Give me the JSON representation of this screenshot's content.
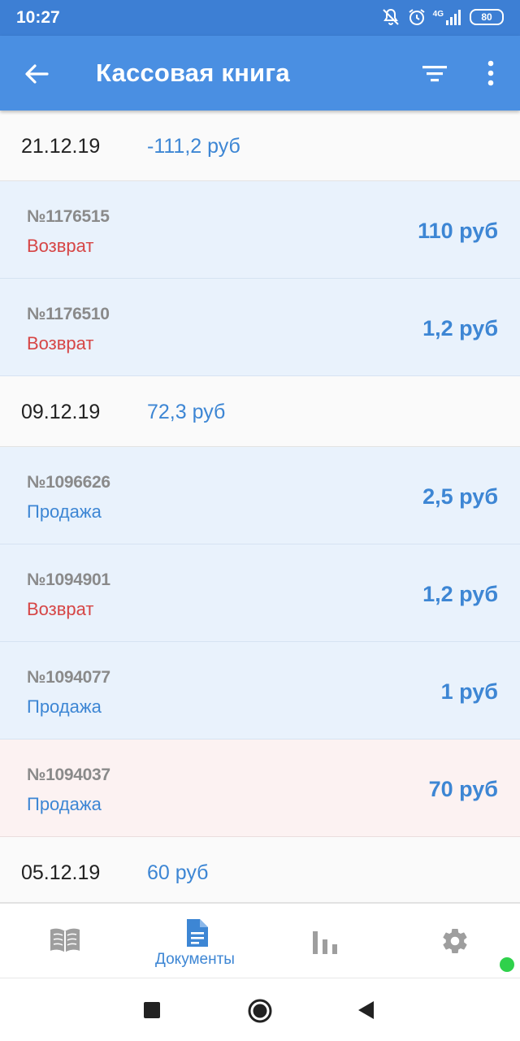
{
  "status_bar": {
    "time": "10:27",
    "network": "4G",
    "battery": "80",
    "icons": [
      "notifications-off-icon",
      "alarm-icon",
      "signal-icon",
      "battery-icon"
    ]
  },
  "app_bar": {
    "title": "Кассовая книга",
    "back_icon": "arrow-left-icon",
    "filter_icon": "filter-icon",
    "more_icon": "more-vertical-icon"
  },
  "list": [
    {
      "kind": "date",
      "date": "21.12.19",
      "total": "-111,2 руб"
    },
    {
      "kind": "doc",
      "number": "№1176515",
      "type": "Возврат",
      "type_color": "red",
      "amount": "110 руб",
      "bg": "blue"
    },
    {
      "kind": "doc",
      "number": "№1176510",
      "type": "Возврат",
      "type_color": "red",
      "amount": "1,2 руб",
      "bg": "blue"
    },
    {
      "kind": "date",
      "date": "09.12.19",
      "total": "72,3 руб"
    },
    {
      "kind": "doc",
      "number": "№1096626",
      "type": "Продажа",
      "type_color": "blue",
      "amount": "2,5 руб",
      "bg": "blue"
    },
    {
      "kind": "doc",
      "number": "№1094901",
      "type": "Возврат",
      "type_color": "red",
      "amount": "1,2 руб",
      "bg": "blue"
    },
    {
      "kind": "doc",
      "number": "№1094077",
      "type": "Продажа",
      "type_color": "blue",
      "amount": "1 руб",
      "bg": "blue"
    },
    {
      "kind": "doc",
      "number": "№1094037",
      "type": "Продажа",
      "type_color": "blue",
      "amount": "70 руб",
      "bg": "pink"
    },
    {
      "kind": "date",
      "date": "05.12.19",
      "total": "60 руб"
    }
  ],
  "bottom_nav": {
    "items": [
      {
        "icon": "book-icon",
        "label": ""
      },
      {
        "icon": "document-icon",
        "label": "Документы",
        "active": true
      },
      {
        "icon": "bar-chart-icon",
        "label": ""
      },
      {
        "icon": "gear-icon",
        "label": ""
      }
    ]
  },
  "system_nav": {
    "icons": [
      "recents-square-icon",
      "home-circle-icon",
      "back-triangle-icon"
    ]
  },
  "colors": {
    "status_bar": "#3d7fd4",
    "app_bar": "#4a8fe2",
    "accent_blue": "#3d86d4",
    "return_red": "#d64545",
    "doc_row_bg": "#e9f2fc",
    "doc_row_pink_bg": "#fcf2f2",
    "online_dot": "#2fd14b"
  }
}
